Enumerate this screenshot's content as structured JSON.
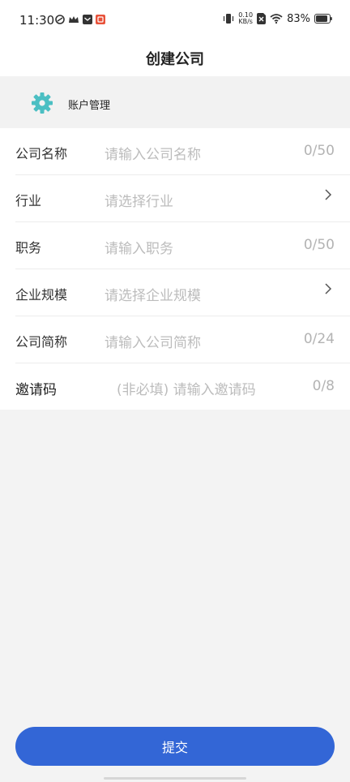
{
  "status_bar": {
    "time": "11:30",
    "net_speed_value": "0.10",
    "net_speed_unit": "KB/s",
    "battery": "83%"
  },
  "header": {
    "title": "创建公司"
  },
  "account": {
    "label": "账户管理"
  },
  "form": {
    "rows": [
      {
        "label": "公司名称",
        "placeholder": "请输入公司名称",
        "counter": "0/50"
      },
      {
        "label": "行业",
        "placeholder": "请选择行业"
      },
      {
        "label": "职务",
        "placeholder": "请输入职务",
        "counter": "0/50"
      },
      {
        "label": "企业规模",
        "placeholder": "请选择企业规模"
      },
      {
        "label": "公司简称",
        "placeholder": "请输入公司简称",
        "counter": "0/24"
      },
      {
        "label": "邀请码",
        "placeholder": "(非必填) 请输入邀请码",
        "counter": "0/8"
      }
    ]
  },
  "footer": {
    "submit_label": "提交"
  },
  "colors": {
    "primary": "#3366d6",
    "gear": "#4bbfc3",
    "placeholder": "#bcbcbc"
  }
}
